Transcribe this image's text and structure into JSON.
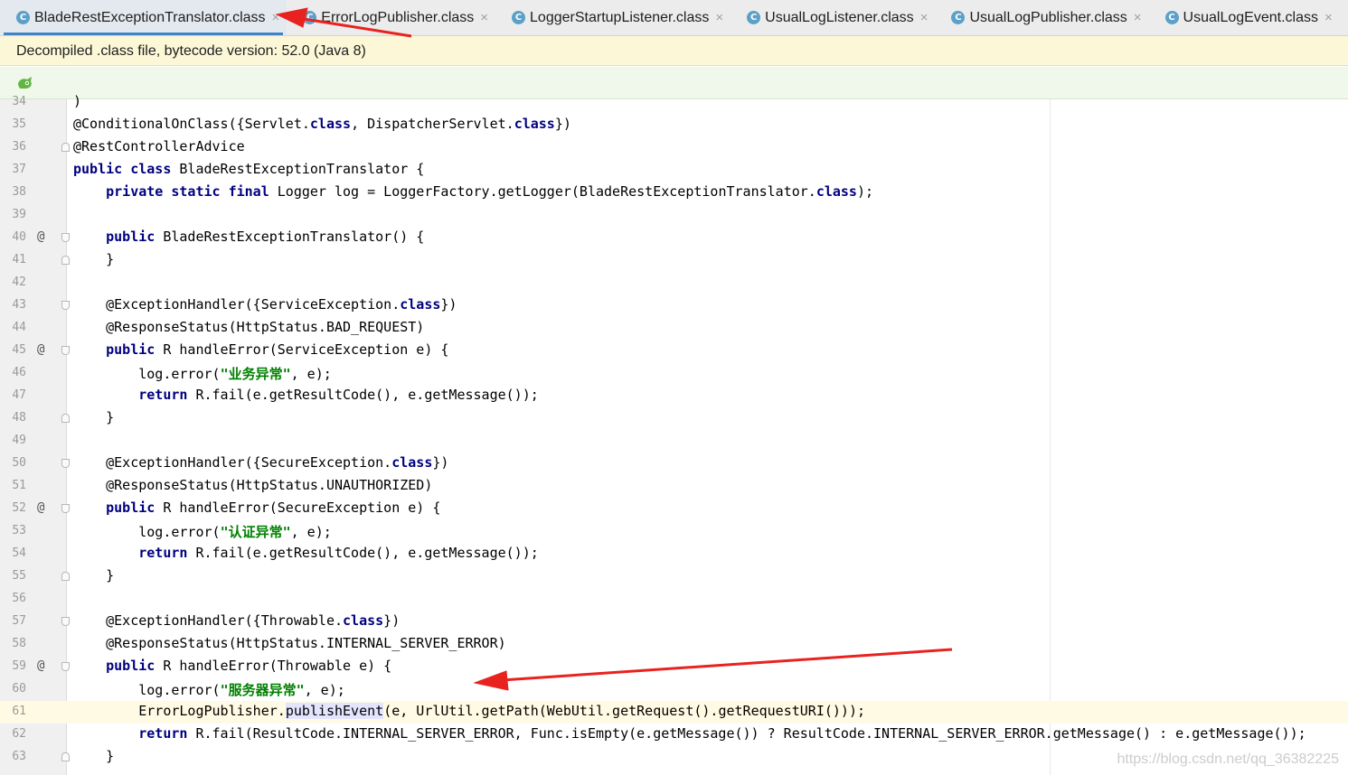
{
  "tabs": [
    {
      "label": "BladeRestExceptionTranslator.class",
      "icon": "class-icon",
      "active": true
    },
    {
      "label": "ErrorLogPublisher.class",
      "icon": "class-icon",
      "active": false
    },
    {
      "label": "LoggerStartupListener.class",
      "icon": "class-icon",
      "active": false
    },
    {
      "label": "UsualLogListener.class",
      "icon": "class-icon",
      "active": false
    },
    {
      "label": "UsualLogPublisher.class",
      "icon": "class-icon",
      "active": false
    },
    {
      "label": "UsualLogEvent.class",
      "icon": "class-icon",
      "active": false
    }
  ],
  "tab_icon_glyph": "C",
  "tab_close_glyph": "×",
  "notice": "Decompiled .class file, bytecode version: 52.0 (Java 8)",
  "accent_color": "#4083c9",
  "watermark": "https://blog.csdn.net/qq_36382225",
  "code_lines": [
    {
      "n": "34",
      "segs": [
        {
          "t": ")"
        }
      ]
    },
    {
      "n": "35",
      "segs": [
        {
          "t": "@ConditionalOnClass({Servlet."
        },
        {
          "t": "class",
          "c": "kw"
        },
        {
          "t": ", DispatcherServlet."
        },
        {
          "t": "class",
          "c": "kw"
        },
        {
          "t": "})"
        }
      ]
    },
    {
      "n": "36",
      "fold": "up",
      "segs": [
        {
          "t": "@RestControllerAdvice"
        }
      ]
    },
    {
      "n": "37",
      "segs": [
        {
          "t": "public class",
          "c": "kw"
        },
        {
          "t": " BladeRestExceptionTranslator {"
        }
      ]
    },
    {
      "n": "38",
      "segs": [
        {
          "t": "    "
        },
        {
          "t": "private static final",
          "c": "kw"
        },
        {
          "t": " Logger log = LoggerFactory.getLogger(BladeRestExceptionTranslator."
        },
        {
          "t": "class",
          "c": "kw"
        },
        {
          "t": ");"
        }
      ]
    },
    {
      "n": "39",
      "segs": []
    },
    {
      "n": "40",
      "at": true,
      "fold": "down",
      "segs": [
        {
          "t": "    "
        },
        {
          "t": "public",
          "c": "kw"
        },
        {
          "t": " BladeRestExceptionTranslator() {"
        }
      ]
    },
    {
      "n": "41",
      "fold": "up",
      "segs": [
        {
          "t": "    }"
        }
      ]
    },
    {
      "n": "42",
      "segs": []
    },
    {
      "n": "43",
      "fold": "down",
      "segs": [
        {
          "t": "    @ExceptionHandler({ServiceException."
        },
        {
          "t": "class",
          "c": "kw"
        },
        {
          "t": "})"
        }
      ]
    },
    {
      "n": "44",
      "segs": [
        {
          "t": "    @ResponseStatus(HttpStatus.BAD_REQUEST)"
        }
      ]
    },
    {
      "n": "45",
      "at": true,
      "fold": "down",
      "segs": [
        {
          "t": "    "
        },
        {
          "t": "public",
          "c": "kw"
        },
        {
          "t": " R handleError(ServiceException e) {"
        }
      ]
    },
    {
      "n": "46",
      "segs": [
        {
          "t": "        log.error("
        },
        {
          "t": "\"业务异常\"",
          "c": "str"
        },
        {
          "t": ", e);"
        }
      ]
    },
    {
      "n": "47",
      "segs": [
        {
          "t": "        "
        },
        {
          "t": "return",
          "c": "kw"
        },
        {
          "t": " R.fail(e.getResultCode(), e.getMessage());"
        }
      ]
    },
    {
      "n": "48",
      "fold": "up",
      "segs": [
        {
          "t": "    }"
        }
      ]
    },
    {
      "n": "49",
      "segs": []
    },
    {
      "n": "50",
      "fold": "down",
      "segs": [
        {
          "t": "    @ExceptionHandler({SecureException."
        },
        {
          "t": "class",
          "c": "kw"
        },
        {
          "t": "})"
        }
      ]
    },
    {
      "n": "51",
      "segs": [
        {
          "t": "    @ResponseStatus(HttpStatus.UNAUTHORIZED)"
        }
      ]
    },
    {
      "n": "52",
      "at": true,
      "fold": "down",
      "segs": [
        {
          "t": "    "
        },
        {
          "t": "public",
          "c": "kw"
        },
        {
          "t": " R handleError(SecureException e) {"
        }
      ]
    },
    {
      "n": "53",
      "segs": [
        {
          "t": "        log.error("
        },
        {
          "t": "\"认证异常\"",
          "c": "str"
        },
        {
          "t": ", e);"
        }
      ]
    },
    {
      "n": "54",
      "segs": [
        {
          "t": "        "
        },
        {
          "t": "return",
          "c": "kw"
        },
        {
          "t": " R.fail(e.getResultCode(), e.getMessage());"
        }
      ]
    },
    {
      "n": "55",
      "fold": "up",
      "segs": [
        {
          "t": "    }"
        }
      ]
    },
    {
      "n": "56",
      "segs": []
    },
    {
      "n": "57",
      "fold": "down",
      "segs": [
        {
          "t": "    @ExceptionHandler({Throwable."
        },
        {
          "t": "class",
          "c": "kw"
        },
        {
          "t": "})"
        }
      ]
    },
    {
      "n": "58",
      "segs": [
        {
          "t": "    @ResponseStatus(HttpStatus.INTERNAL_SERVER_ERROR)"
        }
      ]
    },
    {
      "n": "59",
      "at": true,
      "fold": "down",
      "segs": [
        {
          "t": "    "
        },
        {
          "t": "public",
          "c": "kw"
        },
        {
          "t": " R handleError(Throwable e) {"
        }
      ]
    },
    {
      "n": "60",
      "segs": [
        {
          "t": "        log.error("
        },
        {
          "t": "\"服务器异常\"",
          "c": "str"
        },
        {
          "t": ", e);"
        }
      ]
    },
    {
      "n": "61",
      "caret": true,
      "segs": [
        {
          "t": "        ErrorLogPublisher."
        },
        {
          "t": "publishEvent",
          "c": "hl"
        },
        {
          "t": "(e, UrlUtil.getPath(WebUtil.getRequest().getRequestURI()));"
        }
      ]
    },
    {
      "n": "62",
      "segs": [
        {
          "t": "        "
        },
        {
          "t": "return",
          "c": "kw"
        },
        {
          "t": " R.fail(ResultCode.INTERNAL_SERVER_ERROR, Func.isEmpty(e.getMessage()) ? ResultCode.INTERNAL_SERVER_ERROR.getMessage() : e.getMessage());"
        }
      ]
    },
    {
      "n": "63",
      "fold": "up",
      "segs": [
        {
          "t": "    }"
        }
      ]
    }
  ]
}
